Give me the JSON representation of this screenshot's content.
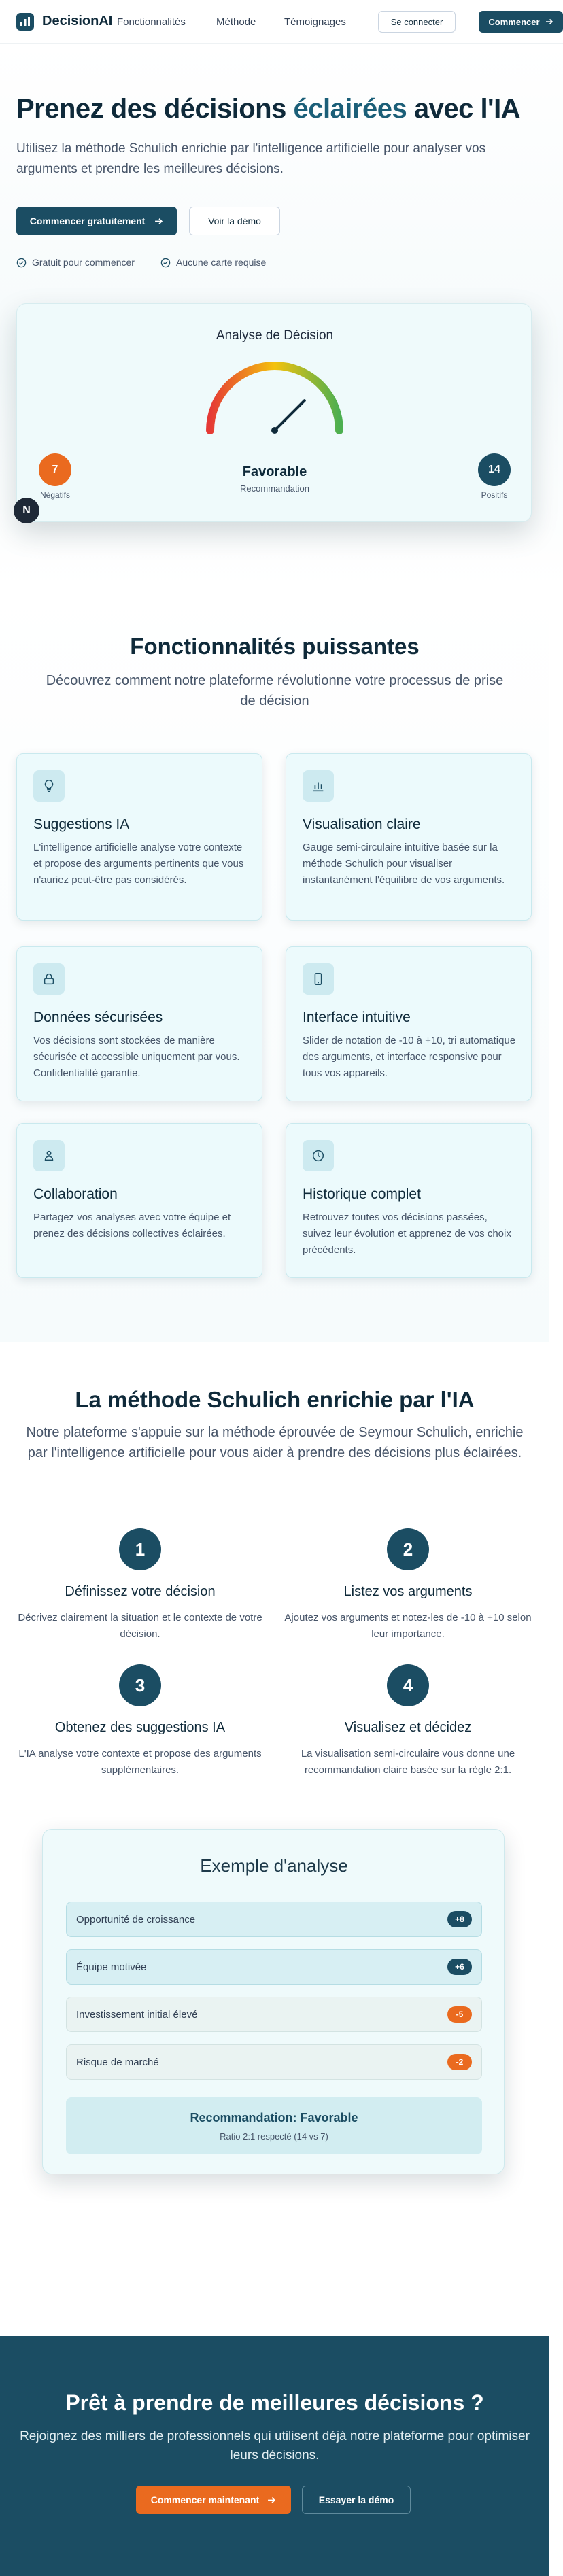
{
  "header": {
    "brand": "DecisionAI",
    "nav": [
      "Fonctionnalités",
      "Méthode",
      "Témoignages"
    ],
    "login_label": "Se connecter",
    "start_label": "Commencer"
  },
  "hero": {
    "title_start": "Prenez des décisions ",
    "title_accent": "éclairées",
    "title_end": " avec l'IA",
    "subtitle": "Utilisez la méthode Schulich enrichie par l'intelligence artificielle pour analyser vos arguments et prendre les meilleures décisions.",
    "cta_primary": "Commencer gratuitement",
    "cta_secondary": "Voir la démo",
    "checks": [
      "Gratuit pour commencer",
      "Aucune carte requise"
    ],
    "analysis": {
      "title": "Analyse de Décision",
      "negative_count": "7",
      "negative_label": "Négatifs",
      "positive_count": "14",
      "positive_label": "Positifs",
      "verdict": "Favorable",
      "verdict_sub": "Recommandation",
      "gauge_level": 0.75
    },
    "badge_letter": "N"
  },
  "features": {
    "title": "Fonctionnalités puissantes",
    "subtitle": "Découvrez comment notre plateforme révolutionne votre processus de prise de décision",
    "items": [
      {
        "icon": "lightbulb-icon",
        "title": "Suggestions IA",
        "desc": "L'intelligence artificielle analyse votre contexte et propose des arguments pertinents que vous n'auriez peut-être pas considérés."
      },
      {
        "icon": "bar-chart-icon",
        "title": "Visualisation claire",
        "desc": "Gauge semi-circulaire intuitive basée sur la méthode Schulich pour visualiser instantanément l'équilibre de vos arguments."
      },
      {
        "icon": "lock-icon",
        "title": "Données sécurisées",
        "desc": "Vos décisions sont stockées de manière sécurisée et accessible uniquement par vous. Confidentialité garantie."
      },
      {
        "icon": "smartphone-icon",
        "title": "Interface intuitive",
        "desc": "Slider de notation de -10 à +10, tri automatique des arguments, et interface responsive pour tous vos appareils."
      },
      {
        "icon": "users-icon",
        "title": "Collaboration",
        "desc": "Partagez vos analyses avec votre équipe et prenez des décisions collectives éclairées."
      },
      {
        "icon": "history-icon",
        "title": "Historique complet",
        "desc": "Retrouvez toutes vos décisions passées, suivez leur évolution et apprenez de vos choix précédents."
      }
    ]
  },
  "method": {
    "title": "La méthode Schulich enrichie par l'IA",
    "subtitle": "Notre plateforme s'appuie sur la méthode éprouvée de Seymour Schulich, enrichie par l'intelligence artificielle pour vous aider à prendre des décisions plus éclairées.",
    "steps": [
      {
        "num": "1",
        "title": "Définissez votre décision",
        "desc": "Décrivez clairement la situation et le contexte de votre décision."
      },
      {
        "num": "2",
        "title": "Listez vos arguments",
        "desc": "Ajoutez vos arguments et notez-les de -10 à +10 selon leur importance."
      },
      {
        "num": "3",
        "title": "Obtenez des suggestions IA",
        "desc": "L'IA analyse votre contexte et propose des arguments supplémentaires."
      },
      {
        "num": "4",
        "title": "Visualisez et décidez",
        "desc": "La visualisation semi-circulaire vous donne une recommandation claire basée sur la règle 2:1."
      }
    ],
    "example": {
      "title": "Exemple d'analyse",
      "rows": [
        {
          "label": "Opportunité de croissance",
          "score": "+8"
        },
        {
          "label": "Équipe motivée",
          "score": "+6"
        },
        {
          "label": "Investissement initial élevé",
          "score": "-5"
        },
        {
          "label": "Risque de marché",
          "score": "-2"
        }
      ],
      "recommendation": "Recommandation: Favorable",
      "ratio": "Ratio 2:1 respecté (14 vs 7)"
    }
  },
  "cta": {
    "title": "Prêt à prendre de meilleures décisions ?",
    "subtitle": "Rejoignez des milliers de professionnels qui utilisent déjà notre plateforme pour optimiser leurs décisions.",
    "primary": "Commencer maintenant",
    "secondary": "Essayer la démo"
  },
  "colors": {
    "brand": "#1b4d63",
    "accent_orange": "#ea6a1f",
    "card_bg": "#ecfafc"
  }
}
